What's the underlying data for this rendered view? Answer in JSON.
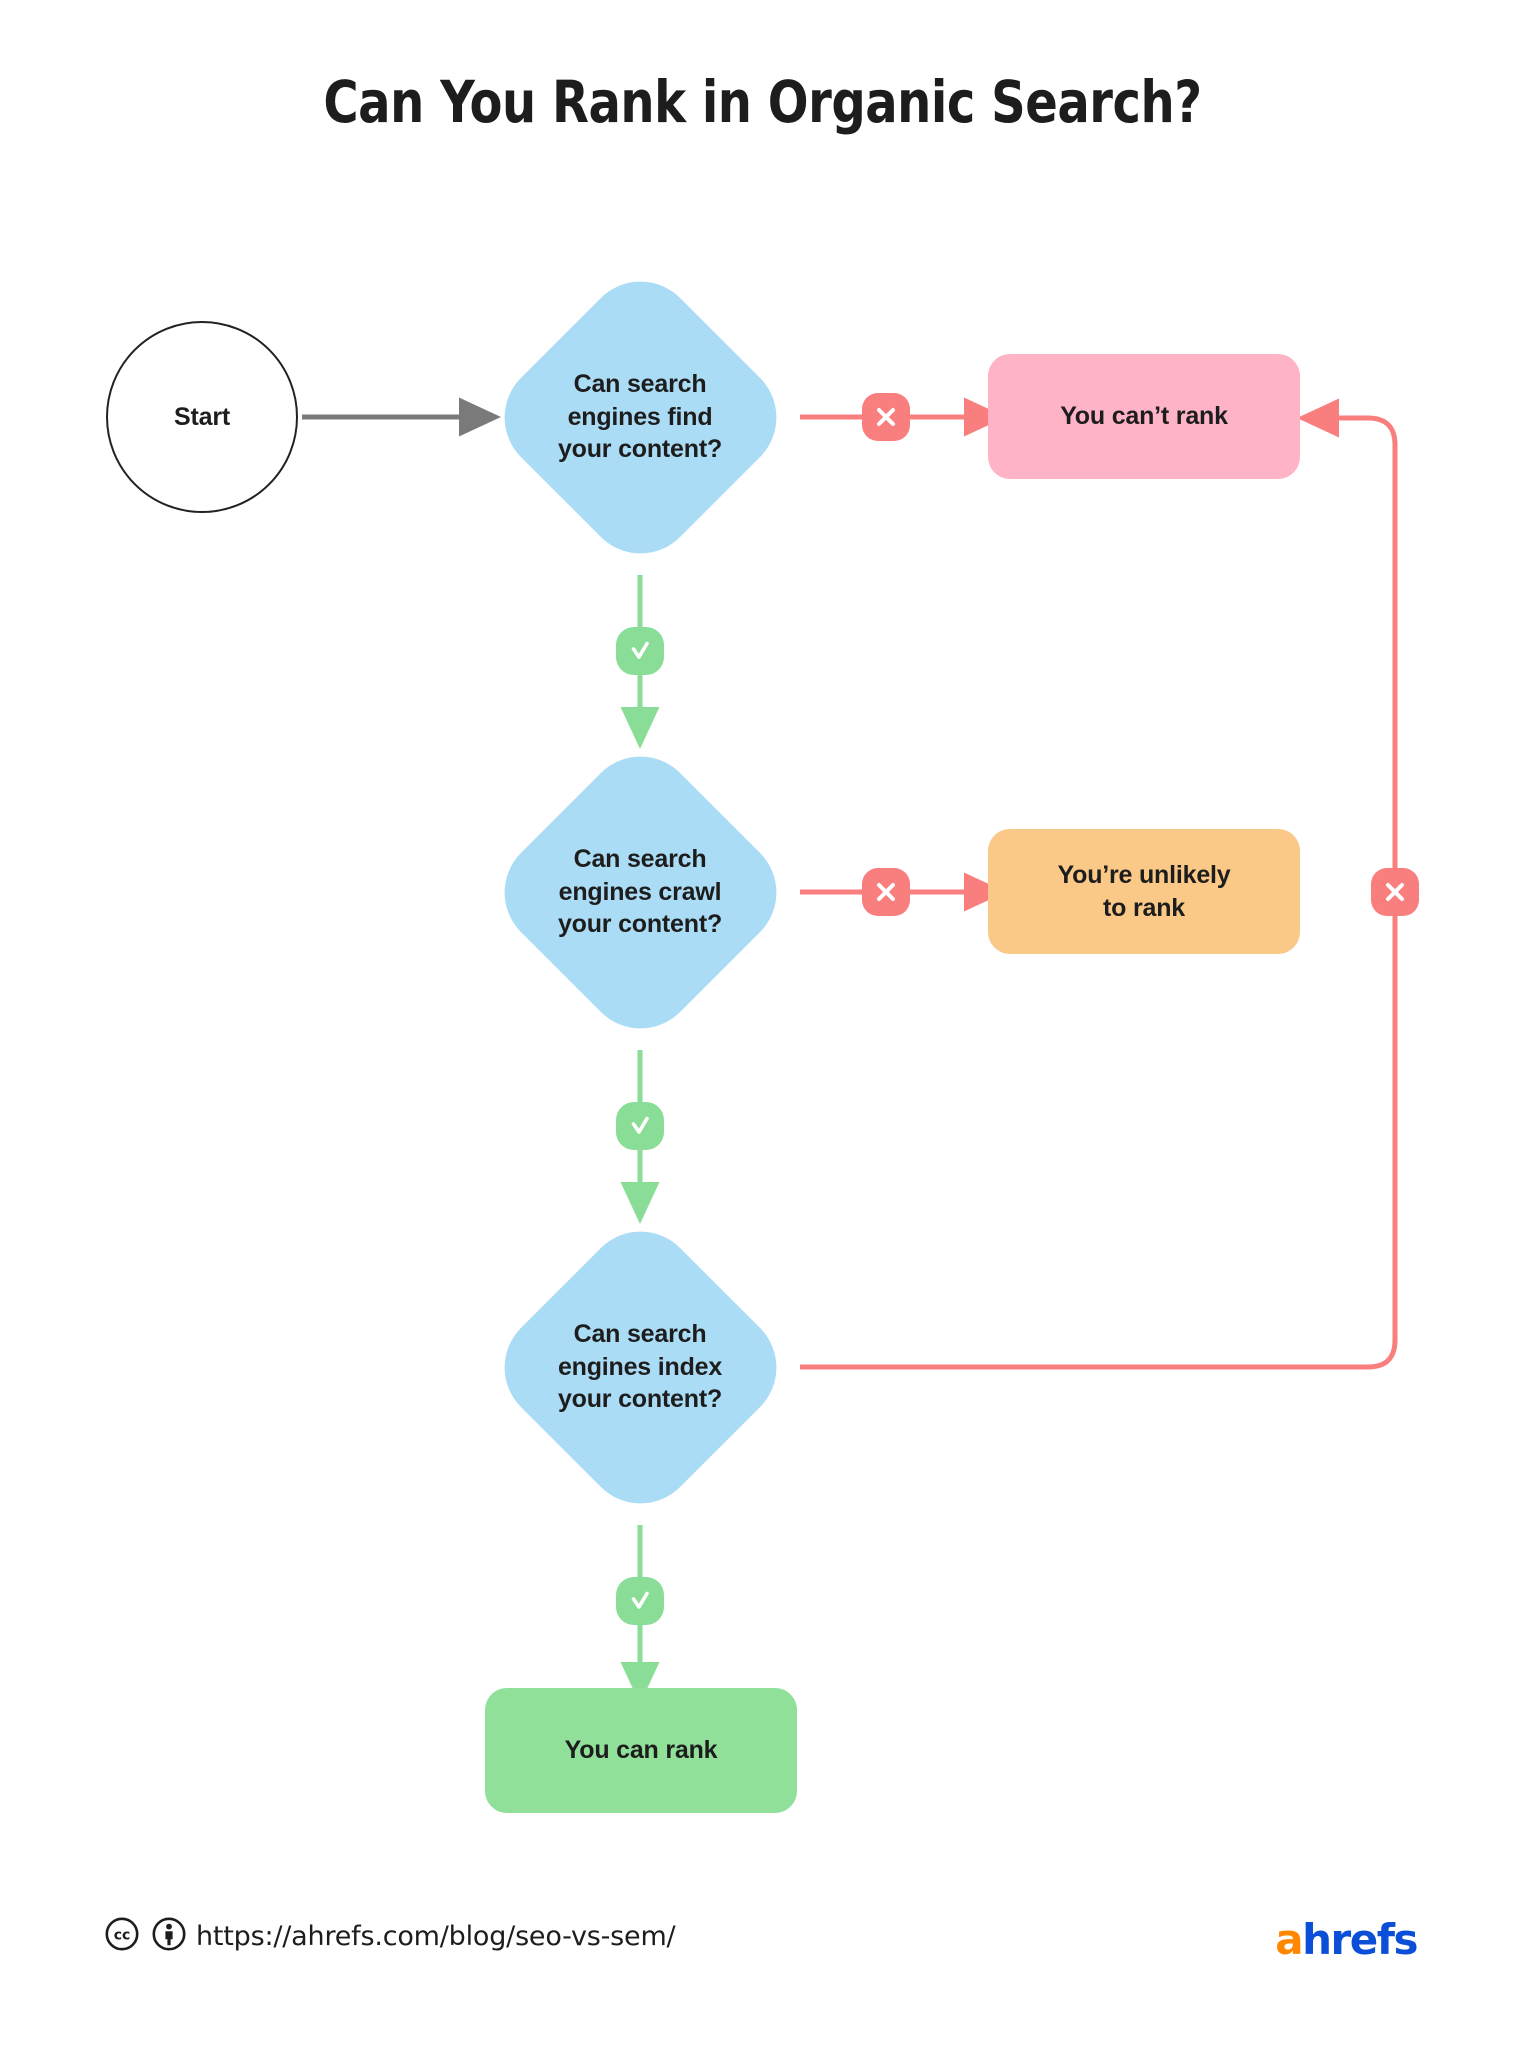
{
  "page": {
    "title": "Can You Rank in Organic Search?",
    "background": "#FFFFFF"
  },
  "colors": {
    "decision": "#ABDCF5",
    "cannot_rank": "#FFB3C7",
    "unlikely": "#FBC987",
    "can_rank": "#90E09A",
    "no_edge": "#F97E7E",
    "yes_edge": "#8ADD96",
    "start_edge": "#7A7A7A",
    "text": "#1D1D1D",
    "logo_orange": "#FF8800",
    "logo_blue": "#0B4ED8"
  },
  "nodes": {
    "start": {
      "label": "Start",
      "shape": "circle"
    },
    "decision_find": {
      "label": "Can search\nengines find\nyour content?",
      "shape": "diamond"
    },
    "decision_crawl": {
      "label": "Can search\nengines crawl\nyour content?",
      "shape": "diamond"
    },
    "decision_index": {
      "label": "Can search\nengines index\nyour content?",
      "shape": "diamond"
    },
    "outcome_cannot_rank": {
      "label": "You can’t rank",
      "shape": "rounded-rect"
    },
    "outcome_unlikely": {
      "label": "You’re unlikely\nto rank",
      "shape": "rounded-rect"
    },
    "outcome_can_rank": {
      "label": "You can rank",
      "shape": "rounded-rect"
    }
  },
  "edges": {
    "start_to_find": {
      "marker": "arrow",
      "label": ""
    },
    "find_no": {
      "marker": "x-icon",
      "label": ""
    },
    "find_yes": {
      "marker": "check-icon",
      "label": ""
    },
    "crawl_no": {
      "marker": "x-icon",
      "label": ""
    },
    "crawl_yes": {
      "marker": "check-icon",
      "label": ""
    },
    "index_no": {
      "marker": "x-icon",
      "label": ""
    },
    "index_yes": {
      "marker": "check-icon",
      "label": ""
    }
  },
  "footer": {
    "url": "https://ahrefs.com/blog/seo-vs-sem/",
    "license_icons": [
      "creative-commons-icon",
      "cc-by-attribution-icon"
    ],
    "logo": {
      "part_a": "a",
      "part_rest": "hrefs"
    }
  }
}
